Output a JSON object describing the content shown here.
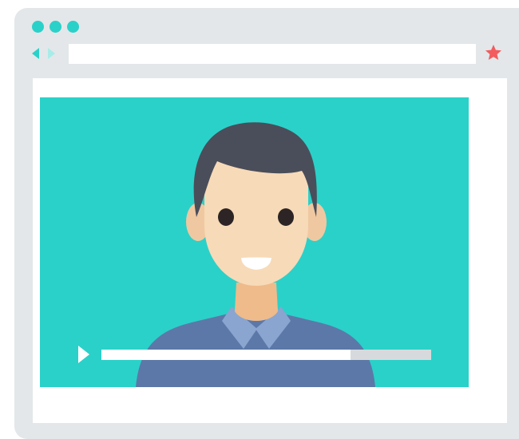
{
  "window": {
    "controls": [
      "window-dot",
      "window-dot",
      "window-dot"
    ],
    "accent_color": "#2ad1c9",
    "frame_color": "#e3e7e9"
  },
  "toolbar": {
    "back_icon": "arrow-left-icon",
    "forward_icon": "arrow-right-icon",
    "address_value": "",
    "bookmark_icon": "star-icon",
    "bookmark_color": "#f25c5f"
  },
  "video": {
    "background_color": "#2ad1c9",
    "play_icon": "play-icon",
    "progress": 0.755
  }
}
